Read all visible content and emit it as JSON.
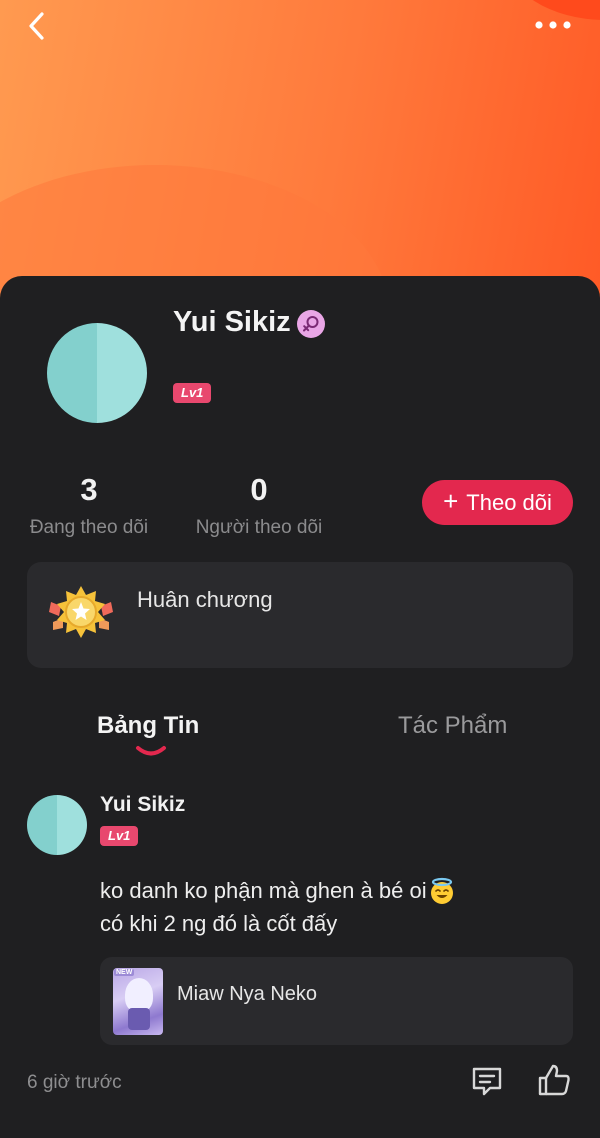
{
  "header": {
    "back_icon": "chevron-left-icon",
    "more_icon": "more-horizontal-icon",
    "gradient_colors": [
      "#ff9a50",
      "#ff5a26"
    ]
  },
  "profile": {
    "name": "Yui Sikiz",
    "gender_icon": "female-icon",
    "level": "Lv1"
  },
  "stats": {
    "following_count": "3",
    "following_label": "Đang theo dõi",
    "followers_count": "0",
    "followers_label": "Người theo dõi"
  },
  "follow_button": {
    "icon": "plus",
    "label": "Theo dõi",
    "color": "#e3284e"
  },
  "medals": {
    "label": "Huân chương",
    "icon": "medal-icon"
  },
  "tabs": [
    {
      "label": "Bảng Tin",
      "active": true
    },
    {
      "label": "Tác Phẩm",
      "active": false
    }
  ],
  "post": {
    "author": "Yui Sikiz",
    "level": "Lv1",
    "text_line1": "ko danh ko phận mà ghen à bé oi",
    "text_line1_emoji": "smiling-face-with-halo",
    "text_line2": "có khi 2 ng đó là cốt đấy",
    "attached_work": {
      "thumb_tag": "NEW",
      "title": "Miaw Nya Neko"
    },
    "time": "6 giờ trước",
    "comment_icon": "comment-icon",
    "like_icon": "thumbs-up-icon"
  }
}
